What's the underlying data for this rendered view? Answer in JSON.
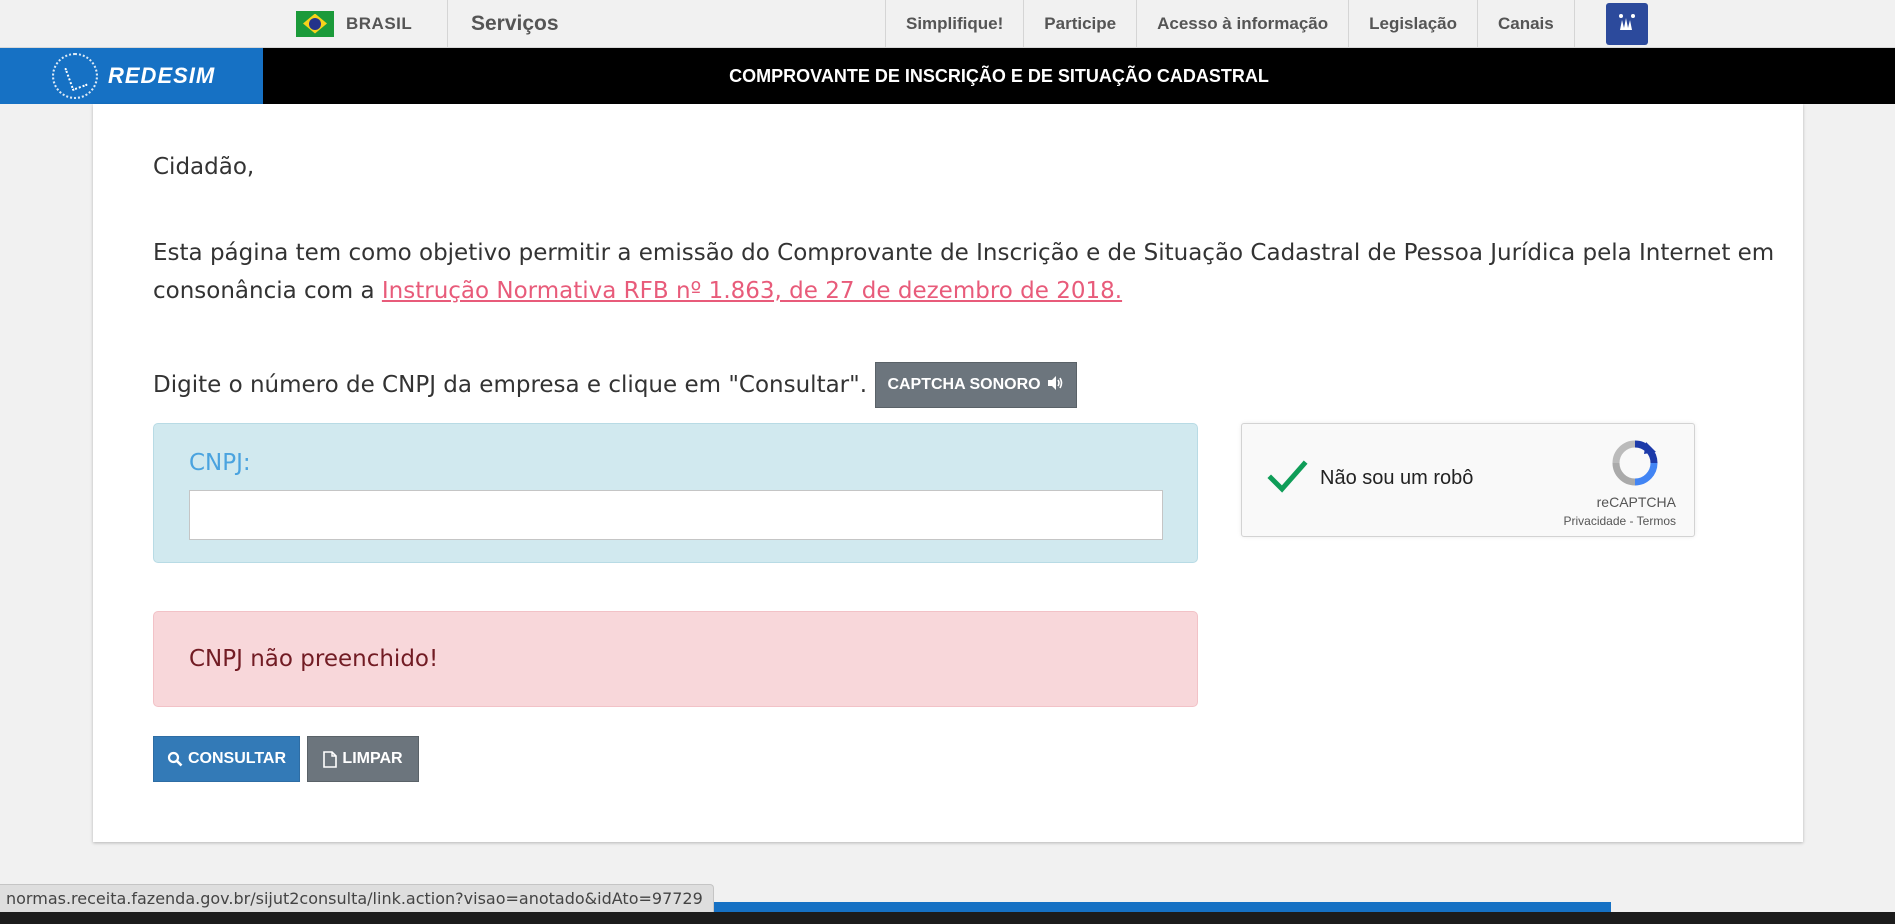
{
  "govbar": {
    "country": "BRASIL",
    "services": "Serviços",
    "links": [
      "Simplifique!",
      "Participe",
      "Acesso à informação",
      "Legislação",
      "Canais"
    ],
    "libras_icon": "hands-icon"
  },
  "redesim": {
    "logo_text": "REDESIM",
    "title": "COMPROVANTE DE INSCRIÇÃO E DE SITUAÇÃO CADASTRAL"
  },
  "content": {
    "greeting": "Cidadão,",
    "intro_text": "Esta página tem como objetivo permitir a emissão do Comprovante de Inscrição e de Situação Cadastral de Pessoa Jurídica pela Internet em consonância com a ",
    "intro_link": "Instrução Normativa RFB nº 1.863, de 27 de dezembro de 2018.",
    "instruction": "Digite o número de CNPJ da empresa e clique em \"Consultar\".",
    "captcha_audio_label": "CAPTCHA SONORO",
    "cnpj_label": "CNPJ:",
    "cnpj_value": "",
    "alert": "CNPJ não preenchido!",
    "consultar_label": "CONSULTAR",
    "limpar_label": "LIMPAR"
  },
  "recaptcha": {
    "label": "Não sou um robô",
    "brand": "reCAPTCHA",
    "privacy": "Privacidade",
    "separator": " - ",
    "terms": "Termos",
    "checked": true
  },
  "status_bar": {
    "url": "normas.receita.fazenda.gov.br/sijut2consulta/link.action?visao=anotado&idAto=97729"
  },
  "colors": {
    "brand_blue": "#1671c4",
    "primary": "#337ab7",
    "alert_bg": "#f8d7da",
    "info_bg": "#d1e9ef",
    "link": "#e85b7a"
  }
}
